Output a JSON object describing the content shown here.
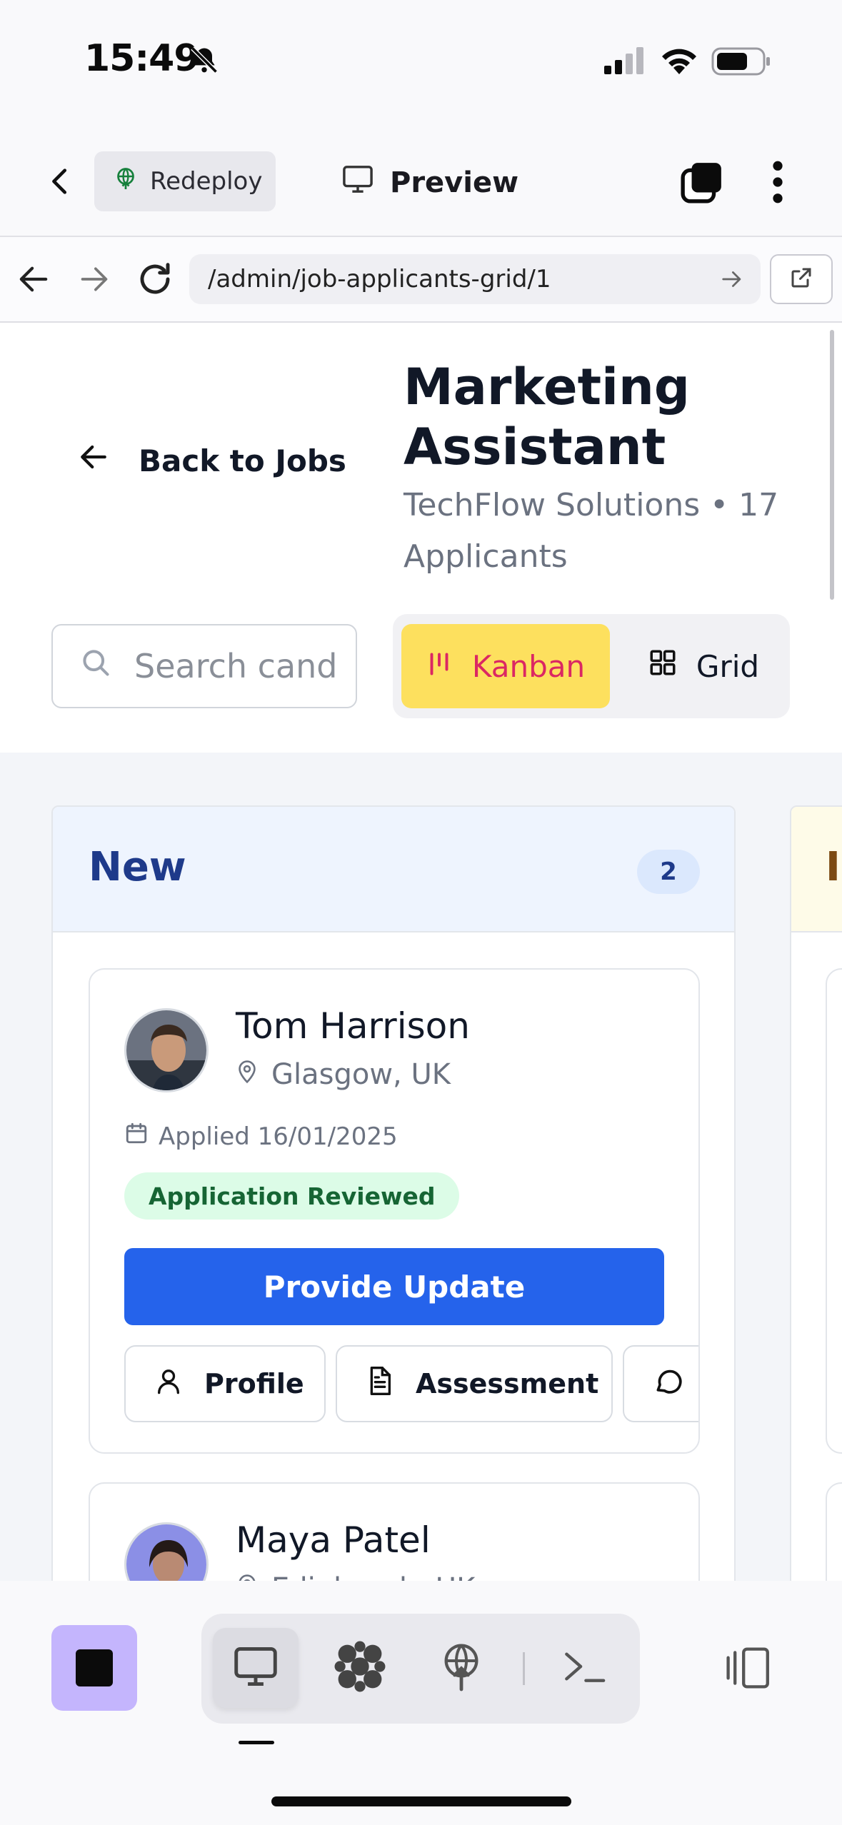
{
  "status_bar": {
    "time": "15:49"
  },
  "app_bar": {
    "redeploy_label": "Redeploy",
    "preview_label": "Preview"
  },
  "browser": {
    "url": "/admin/job-applicants-grid/1"
  },
  "page": {
    "back_label": "Back to Jobs",
    "job_title": "Marketing Assistant",
    "job_subtitle": "TechFlow Solutions • 17 Applicants",
    "search_placeholder": "Search cand",
    "view_toggle": {
      "kanban_label": "Kanban",
      "grid_label": "Grid",
      "active": "Kanban"
    }
  },
  "board": {
    "columns": [
      {
        "name": "New",
        "count": "2",
        "cards": [
          {
            "name": "Tom Harrison",
            "location": "Glasgow, UK",
            "applied": "Applied 16/01/2025",
            "status": "Application Reviewed",
            "primary_action": "Provide Update",
            "actions": [
              "Profile",
              "Assessment",
              "Me"
            ]
          },
          {
            "name": "Maya Patel",
            "location": "Edinburgh, UK"
          }
        ]
      },
      {
        "name": "In"
      }
    ]
  },
  "colors": {
    "kanban_bg": "#fde05e",
    "kanban_text": "#db2763",
    "primary_button": "#2563eb",
    "column_new_header": "#eef4fe",
    "badge_bg": "#dcfce7",
    "badge_text": "#166534",
    "stop_button": "#c4b5fd"
  }
}
